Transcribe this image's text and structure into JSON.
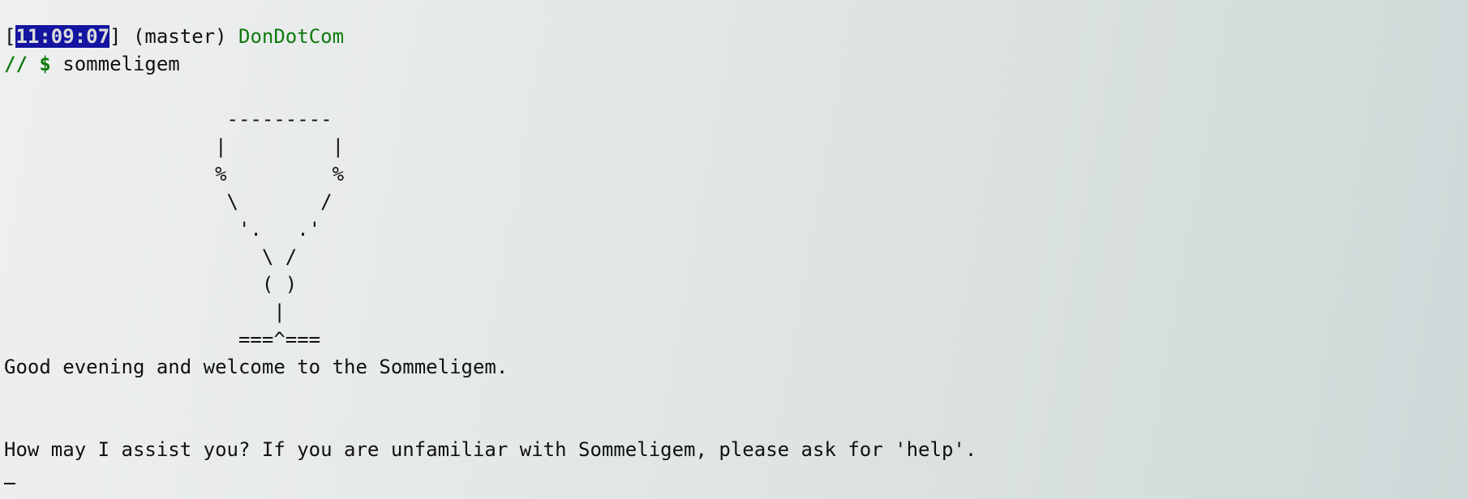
{
  "prompt": {
    "open_bracket": "[",
    "time": "11:09:07",
    "close_bracket": "]",
    "branch": " (master) ",
    "user": "DonDotCom",
    "path": "//",
    "symbol": "$",
    "command": "sommeligem"
  },
  "ascii_art": [
    "                   ---------",
    "                  |         |",
    "                  %         %",
    "                   \\       /",
    "                    '.   .'",
    "                      \\ /",
    "                      ( )",
    "                       |",
    "                    ===^==="
  ],
  "output": {
    "welcome": "Good evening and welcome to the Sommeligem.",
    "question": "How may I assist you? If you are unfamiliar with Sommeligem, please ask for 'help'."
  }
}
